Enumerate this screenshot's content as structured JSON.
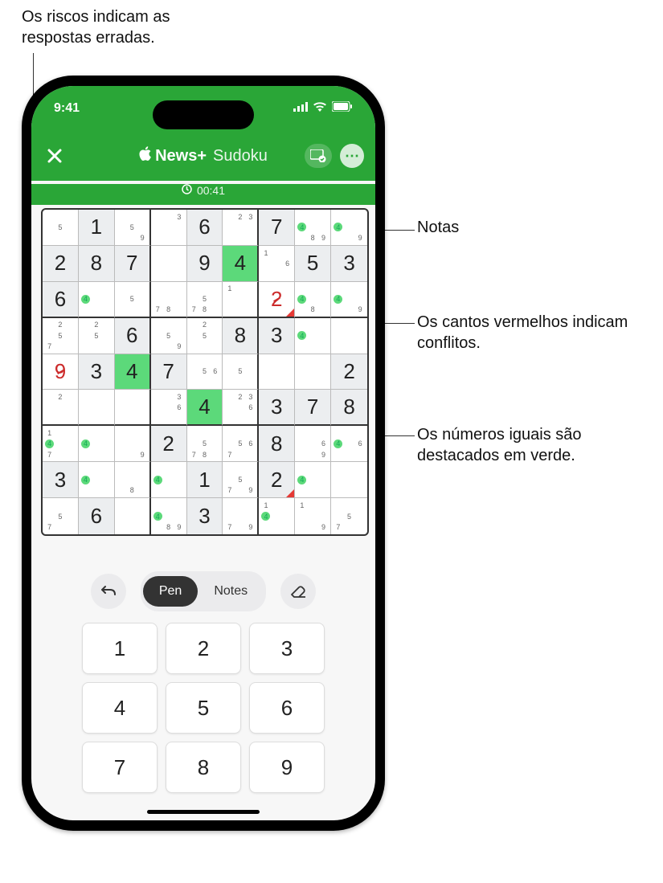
{
  "callouts": {
    "top_left": "Os riscos indicam as respostas erradas.",
    "notes": "Notas",
    "conflict": "Os cantos vermelhos indicam conflitos.",
    "highlight": "Os números iguais são destacados em verde."
  },
  "status": {
    "time": "9:41"
  },
  "header": {
    "brand": "News+",
    "suffix": "Sudoku"
  },
  "timer": "00:41",
  "tools": {
    "pen": "Pen",
    "notes": "Notes"
  },
  "keypad": [
    "1",
    "2",
    "3",
    "4",
    "5",
    "6",
    "7",
    "8",
    "9"
  ],
  "grid": [
    [
      {
        "t": "e",
        "notes": {
          "5": false
        }
      },
      {
        "t": "f",
        "v": "1"
      },
      {
        "t": "e",
        "notes": {
          "5": false,
          "9": false
        }
      },
      {
        "t": "e",
        "notes": {
          "3": false
        }
      },
      {
        "t": "f",
        "v": "6"
      },
      {
        "t": "e",
        "notes": {
          "2": false,
          "3": false
        }
      },
      {
        "t": "f",
        "v": "7"
      },
      {
        "t": "e",
        "notes": {
          "4": true,
          "8": false,
          "9": false
        }
      },
      {
        "t": "e",
        "notes": {
          "4": true,
          "9": false
        }
      }
    ],
    [
      {
        "t": "f",
        "v": "2"
      },
      {
        "t": "f",
        "v": "8"
      },
      {
        "t": "f",
        "v": "7"
      },
      {
        "t": "e"
      },
      {
        "t": "f",
        "v": "9"
      },
      {
        "t": "h",
        "v": "4"
      },
      {
        "t": "e",
        "notes": {
          "1": false,
          "6": false
        }
      },
      {
        "t": "f",
        "v": "5"
      },
      {
        "t": "f",
        "v": "3"
      }
    ],
    [
      {
        "t": "f",
        "v": "6"
      },
      {
        "t": "e",
        "notes": {
          "4": true
        }
      },
      {
        "t": "e",
        "notes": {
          "5": false
        }
      },
      {
        "t": "e",
        "notes": {
          "7": false,
          "8": false
        }
      },
      {
        "t": "e",
        "notes": {
          "5": false,
          "7": false,
          "8": false
        }
      },
      {
        "t": "e",
        "notes": {
          "1": false
        }
      },
      {
        "t": "s",
        "v": "2",
        "corner": true
      },
      {
        "t": "e",
        "notes": {
          "4": true,
          "8": false
        }
      },
      {
        "t": "e",
        "notes": {
          "4": true,
          "9": false
        }
      }
    ],
    [
      {
        "t": "e",
        "notes": {
          "2": false,
          "5": false,
          "7": false
        }
      },
      {
        "t": "e",
        "notes": {
          "2": false,
          "5": false
        }
      },
      {
        "t": "f",
        "v": "6"
      },
      {
        "t": "e",
        "notes": {
          "5": false,
          "9": false
        }
      },
      {
        "t": "e",
        "notes": {
          "2": false,
          "5": false
        }
      },
      {
        "t": "f",
        "v": "8"
      },
      {
        "t": "f",
        "v": "3"
      },
      {
        "t": "e",
        "notes": {
          "4": true
        }
      },
      {
        "t": "e"
      }
    ],
    [
      {
        "t": "s",
        "v": "9"
      },
      {
        "t": "f",
        "v": "3"
      },
      {
        "t": "h",
        "v": "4"
      },
      {
        "t": "f",
        "v": "7"
      },
      {
        "t": "e",
        "notes": {
          "5": false,
          "6": false
        }
      },
      {
        "t": "e",
        "notes": {
          "5": false
        }
      },
      {
        "t": "e"
      },
      {
        "t": "e"
      },
      {
        "t": "f",
        "v": "2"
      }
    ],
    [
      {
        "t": "e",
        "notes": {
          "2": false
        }
      },
      {
        "t": "e"
      },
      {
        "t": "e"
      },
      {
        "t": "e",
        "notes": {
          "3": false,
          "6": false
        }
      },
      {
        "t": "h",
        "v": "4"
      },
      {
        "t": "e",
        "notes": {
          "2": false,
          "3": false,
          "6": false
        }
      },
      {
        "t": "f",
        "v": "3"
      },
      {
        "t": "f",
        "v": "7"
      },
      {
        "t": "f",
        "v": "8"
      }
    ],
    [
      {
        "t": "e",
        "notes": {
          "1": false,
          "4": true,
          "7": false
        }
      },
      {
        "t": "e",
        "notes": {
          "4": true
        }
      },
      {
        "t": "e",
        "notes": {
          "9": false
        }
      },
      {
        "t": "f",
        "v": "2"
      },
      {
        "t": "e",
        "notes": {
          "5": false,
          "7": false,
          "8": false
        }
      },
      {
        "t": "e",
        "notes": {
          "5": false,
          "6": false,
          "7": false
        }
      },
      {
        "t": "f",
        "v": "8"
      },
      {
        "t": "e",
        "notes": {
          "6": false,
          "9": false
        }
      },
      {
        "t": "e",
        "notes": {
          "4": true,
          "6": false
        }
      }
    ],
    [
      {
        "t": "f",
        "v": "3"
      },
      {
        "t": "e",
        "notes": {
          "4": true
        }
      },
      {
        "t": "e",
        "notes": {
          "8": false
        }
      },
      {
        "t": "e",
        "notes": {
          "4": true
        }
      },
      {
        "t": "f",
        "v": "1"
      },
      {
        "t": "e",
        "notes": {
          "5": false,
          "7": false,
          "9": false
        }
      },
      {
        "t": "f",
        "v": "2",
        "corner": true
      },
      {
        "t": "e",
        "notes": {
          "4": true
        }
      },
      {
        "t": "e"
      }
    ],
    [
      {
        "t": "e",
        "notes": {
          "5": false,
          "7": false
        }
      },
      {
        "t": "f",
        "v": "6"
      },
      {
        "t": "e"
      },
      {
        "t": "e",
        "notes": {
          "4": true,
          "8": false,
          "9": false
        }
      },
      {
        "t": "f",
        "v": "3"
      },
      {
        "t": "e",
        "notes": {
          "7": false,
          "9": false
        }
      },
      {
        "t": "e",
        "notes": {
          "1": false,
          "4": true
        }
      },
      {
        "t": "e",
        "notes": {
          "1": false,
          "9": false
        }
      },
      {
        "t": "e",
        "notes": {
          "5": false,
          "7": false
        }
      }
    ]
  ]
}
